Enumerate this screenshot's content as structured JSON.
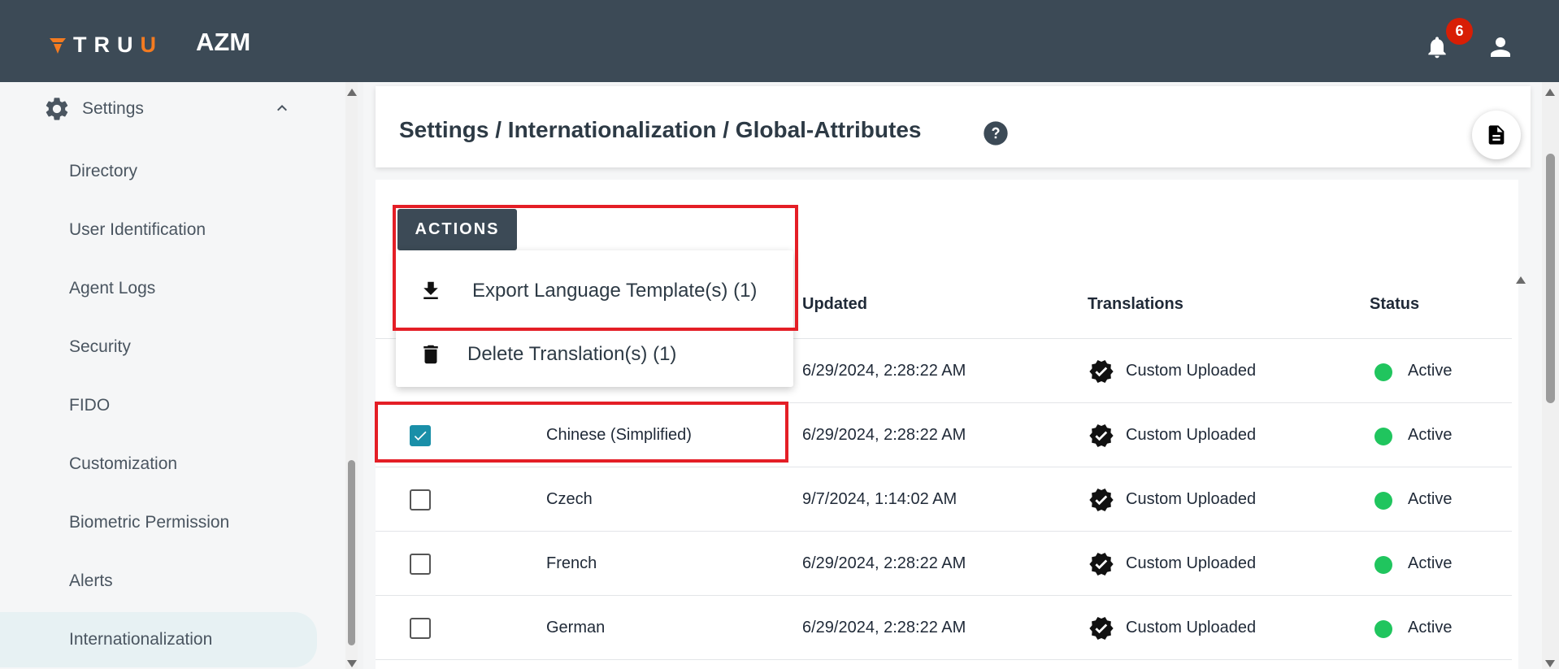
{
  "topbar": {
    "logo_text_main": "TRU",
    "logo_text_accent": "U",
    "app_name": "AZM",
    "notification_count": "6"
  },
  "sidebar": {
    "section_label": "Settings",
    "items": [
      {
        "label": "Directory",
        "active": false
      },
      {
        "label": "User Identification",
        "active": false
      },
      {
        "label": "Agent Logs",
        "active": false
      },
      {
        "label": "Security",
        "active": false
      },
      {
        "label": "FIDO",
        "active": false
      },
      {
        "label": "Customization",
        "active": false
      },
      {
        "label": "Biometric Permission",
        "active": false
      },
      {
        "label": "Alerts",
        "active": false
      },
      {
        "label": "Internationalization",
        "active": true
      }
    ]
  },
  "header": {
    "title": "Settings / Internationalization / Global-Attributes"
  },
  "actions": {
    "button_label": "ACTIONS",
    "menu": [
      {
        "label": "Export Language Template(s) (1)",
        "icon": "download-icon"
      },
      {
        "label": "Delete Translation(s) (1)",
        "icon": "trash-icon"
      }
    ]
  },
  "table": {
    "columns": {
      "updated": "Updated",
      "translations": "Translations",
      "status": "Status"
    },
    "rows": [
      {
        "checked": false,
        "language": "",
        "updated": "6/29/2024, 2:28:22 AM",
        "translation": "Custom Uploaded",
        "status": "Active"
      },
      {
        "checked": true,
        "language": "Chinese (Simplified)",
        "updated": "6/29/2024, 2:28:22 AM",
        "translation": "Custom Uploaded",
        "status": "Active"
      },
      {
        "checked": false,
        "language": "Czech",
        "updated": "9/7/2024, 1:14:02 AM",
        "translation": "Custom Uploaded",
        "status": "Active"
      },
      {
        "checked": false,
        "language": "French",
        "updated": "6/29/2024, 2:28:22 AM",
        "translation": "Custom Uploaded",
        "status": "Active"
      },
      {
        "checked": false,
        "language": "German",
        "updated": "6/29/2024, 2:28:22 AM",
        "translation": "Custom Uploaded",
        "status": "Active"
      }
    ]
  },
  "colors": {
    "topbar_bg": "#3c4a56",
    "brand_accent": "#f47b20",
    "badge": "#d81e05",
    "checkbox_checked": "#1a8fa8",
    "status_active": "#20c55e",
    "highlight": "#e41e26"
  }
}
